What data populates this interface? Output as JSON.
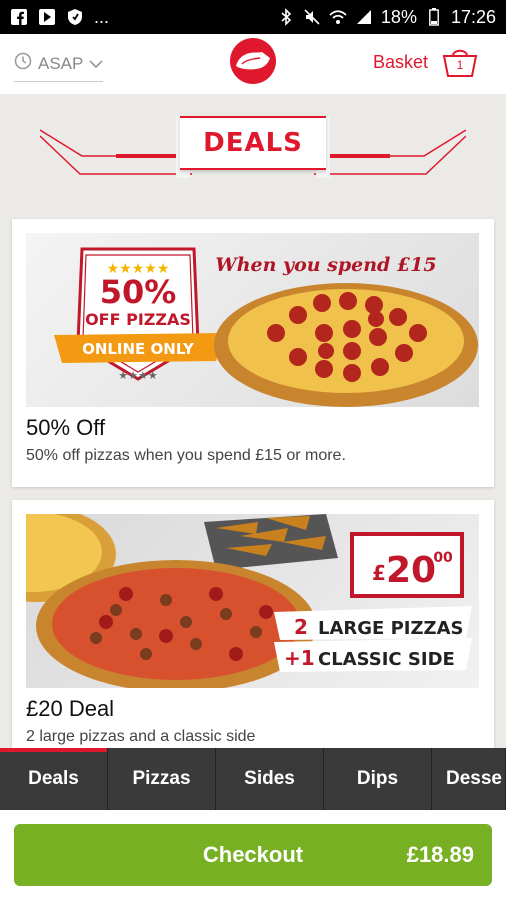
{
  "status_bar": {
    "battery": "18%",
    "time": "17:26",
    "more": "..."
  },
  "header": {
    "delivery_time": "ASAP",
    "basket_label": "Basket",
    "basket_count": "1",
    "accent_color": "#e0182d"
  },
  "section": {
    "title": "DEALS"
  },
  "deals": [
    {
      "title": "50% Off",
      "description": "50% off pizzas when you spend £15 or more.",
      "image_text": {
        "badge_top": "50%",
        "badge_mid": "OFF PIZZAS",
        "ribbon": "ONLINE ONLY",
        "tagline": "When you spend £15"
      }
    },
    {
      "title": "£20 Deal",
      "description": "2 large pizzas and a classic side",
      "image_text": {
        "price_symbol": "£",
        "price_main": "20",
        "price_cents": ".00",
        "line1_num": "2",
        "line1_text": "LARGE PIZZAS",
        "line2_num": "+1",
        "line2_text": "CLASSIC SIDE"
      }
    }
  ],
  "nav": {
    "items": [
      "Deals",
      "Pizzas",
      "Sides",
      "Dips",
      "Desse"
    ],
    "active_index": 0
  },
  "checkout": {
    "label": "Checkout",
    "total": "£18.89",
    "color": "#78b024"
  }
}
